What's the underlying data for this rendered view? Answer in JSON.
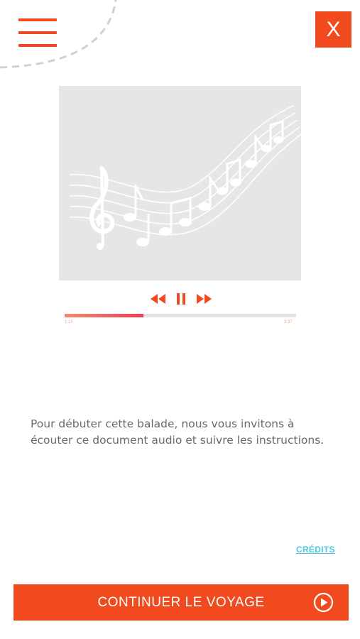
{
  "header": {
    "menu_icon": "hamburger-icon",
    "close_label": "X"
  },
  "player": {
    "artwork_icon": "music-staff-notes-illustration",
    "controls": [
      "rewind-icon",
      "pause-icon",
      "fast-forward-icon"
    ],
    "progress": 0.34,
    "elapsed": "1:15",
    "total": "3:37"
  },
  "content": {
    "intro_line1": "Pour débuter cette balade, nous vous invitons à",
    "intro_line2": "écouter ce document audio et suivre les instructions."
  },
  "footer": {
    "credits_label": "CRÉDITS",
    "cta_label": "CONTINUER LE VOYAGE",
    "cta_icon": "play-circle-icon"
  },
  "colors": {
    "accent": "#f14a1f",
    "link": "#4fc6dc",
    "progress_start": "#f08a6e",
    "progress_end": "#ee3d56"
  }
}
